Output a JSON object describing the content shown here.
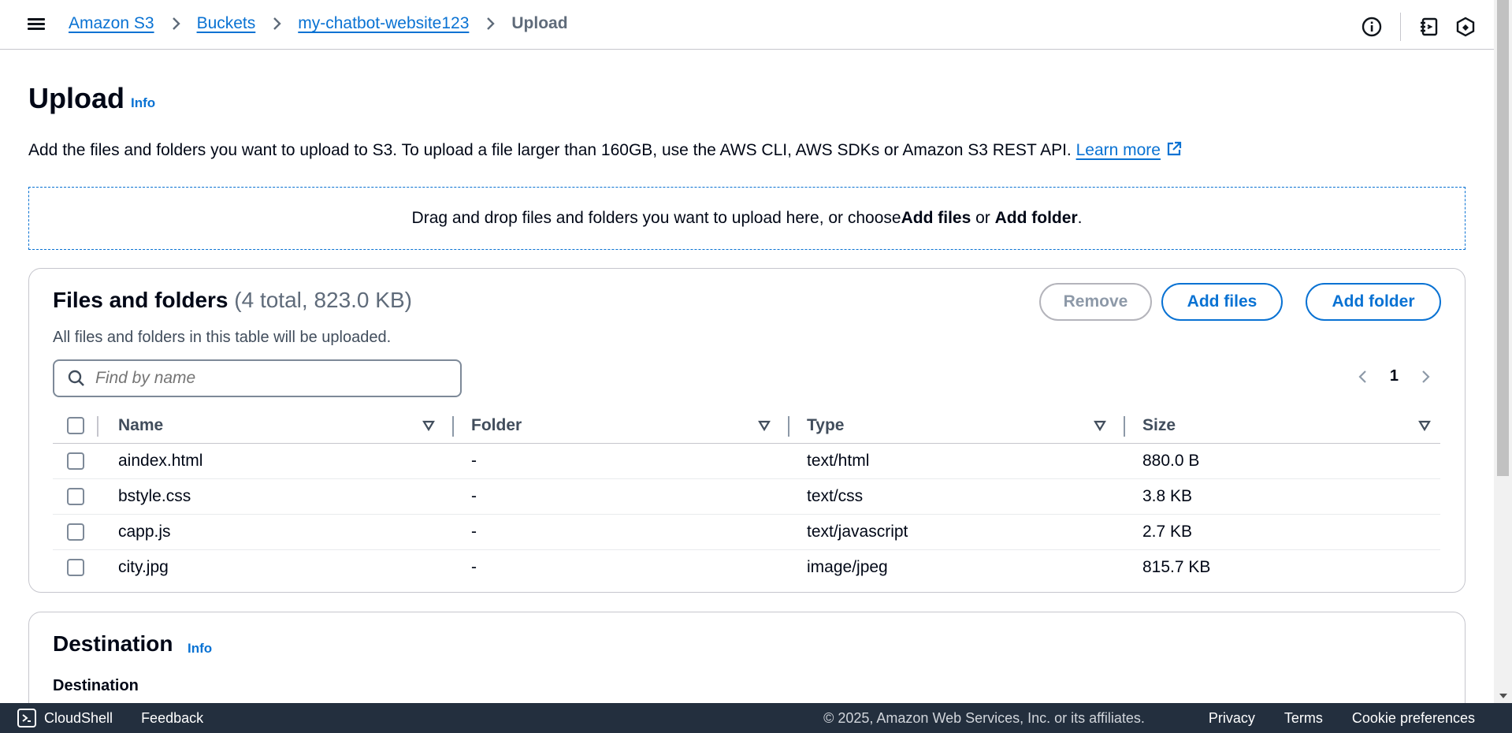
{
  "breadcrumb": {
    "items": [
      "Amazon S3",
      "Buckets",
      "my-chatbot-website123"
    ],
    "current": "Upload"
  },
  "header": {
    "title": "Upload",
    "info": "Info",
    "description": "Add the files and folders you want to upload to S3. To upload a file larger than 160GB, use the AWS CLI, AWS SDKs or Amazon S3 REST API.",
    "learn_more": "Learn more"
  },
  "dropzone": {
    "text_before": "Drag and drop files and folders you want to upload here, or choose ",
    "add_files": "Add files",
    "or": " or ",
    "add_folder": "Add folder",
    "period": "."
  },
  "files": {
    "title": "Files and folders",
    "count": "(4 total, 823.0 KB)",
    "subtitle": "All files and folders in this table will be uploaded.",
    "remove_label": "Remove",
    "add_files_label": "Add files",
    "add_folder_label": "Add folder",
    "search_placeholder": "Find by name",
    "page": "1",
    "columns": [
      "Name",
      "Folder",
      "Type",
      "Size"
    ],
    "rows": [
      {
        "name": "aindex.html",
        "folder": "-",
        "type": "text/html",
        "size": "880.0 B"
      },
      {
        "name": "bstyle.css",
        "folder": "-",
        "type": "text/css",
        "size": "3.8 KB"
      },
      {
        "name": "capp.js",
        "folder": "-",
        "type": "text/javascript",
        "size": "2.7 KB"
      },
      {
        "name": "city.jpg",
        "folder": "-",
        "type": "image/jpeg",
        "size": "815.7 KB"
      }
    ]
  },
  "destination": {
    "title": "Destination",
    "info": "Info",
    "subtitle": "Destination"
  },
  "footer": {
    "cloudshell": "CloudShell",
    "feedback": "Feedback",
    "copyright": "© 2025, Amazon Web Services, Inc. or its affiliates.",
    "privacy": "Privacy",
    "terms": "Terms",
    "cookies": "Cookie preferences"
  },
  "colors": {
    "link": "#0972d3",
    "footer_bg": "#232f3e",
    "text": "#000716"
  }
}
